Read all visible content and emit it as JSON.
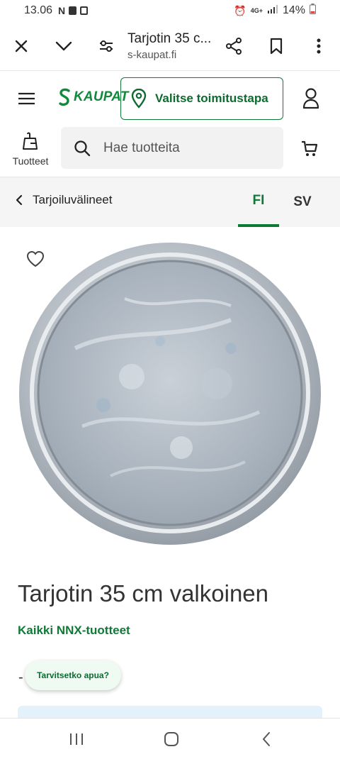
{
  "status_bar": {
    "time": "13.06",
    "battery": "14%",
    "network": "4G+"
  },
  "browser": {
    "tab_title": "Tarjotin 35 c...",
    "url": "s-kaupat.fi"
  },
  "header": {
    "logo_text": "KAUPAT",
    "delivery_label": "Valitse toimitustapa"
  },
  "search": {
    "products_label": "Tuotteet",
    "placeholder": "Hae tuotteita"
  },
  "breadcrumb": {
    "label": "Tarjoiluvälineet",
    "lang_fi": "FI",
    "lang_sv": "SV"
  },
  "product": {
    "title": "Tarjotin 35 cm valkoinen",
    "brand_link": "Kaikki NNX-tuotteet",
    "partial_text": "-"
  },
  "help": {
    "label": "Tarvitsetko apua?"
  },
  "colors": {
    "brand_green": "#0e7a35",
    "info_blue": "#e3f1fb"
  }
}
